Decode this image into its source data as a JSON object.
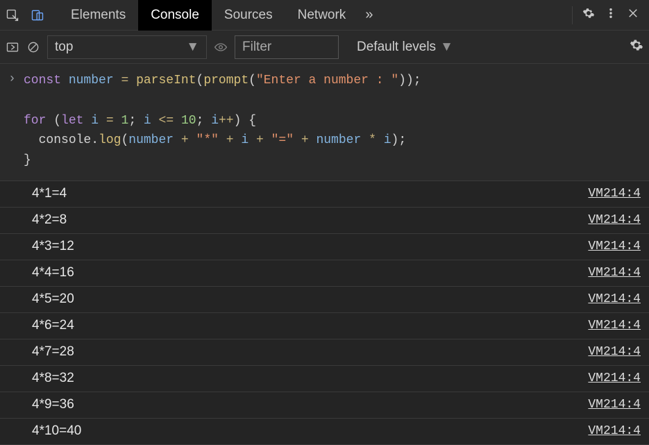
{
  "tabs": {
    "items": [
      "Elements",
      "Console",
      "Sources",
      "Network"
    ],
    "active": "Console",
    "overflow_glyph": "»"
  },
  "toolbar": {
    "context": "top",
    "filter_placeholder": "Filter",
    "levels_label": "Default levels"
  },
  "source_code": {
    "lines": [
      [
        {
          "t": "kw",
          "v": "const"
        },
        {
          "t": "sp",
          "v": " "
        },
        {
          "t": "var",
          "v": "number"
        },
        {
          "t": "sp",
          "v": " "
        },
        {
          "t": "op",
          "v": "="
        },
        {
          "t": "sp",
          "v": " "
        },
        {
          "t": "fn",
          "v": "parseInt"
        },
        {
          "t": "punc",
          "v": "("
        },
        {
          "t": "fn",
          "v": "prompt"
        },
        {
          "t": "punc",
          "v": "("
        },
        {
          "t": "str",
          "v": "\"Enter a number : \""
        },
        {
          "t": "punc",
          "v": "));"
        }
      ],
      [],
      [
        {
          "t": "kw",
          "v": "for"
        },
        {
          "t": "sp",
          "v": " "
        },
        {
          "t": "punc",
          "v": "("
        },
        {
          "t": "kw",
          "v": "let"
        },
        {
          "t": "sp",
          "v": " "
        },
        {
          "t": "var",
          "v": "i"
        },
        {
          "t": "sp",
          "v": " "
        },
        {
          "t": "op",
          "v": "="
        },
        {
          "t": "sp",
          "v": " "
        },
        {
          "t": "num",
          "v": "1"
        },
        {
          "t": "punc",
          "v": "; "
        },
        {
          "t": "var",
          "v": "i"
        },
        {
          "t": "sp",
          "v": " "
        },
        {
          "t": "op",
          "v": "<="
        },
        {
          "t": "sp",
          "v": " "
        },
        {
          "t": "num",
          "v": "10"
        },
        {
          "t": "punc",
          "v": "; "
        },
        {
          "t": "var",
          "v": "i"
        },
        {
          "t": "op",
          "v": "++"
        },
        {
          "t": "punc",
          "v": ") {"
        }
      ],
      [
        {
          "t": "sp",
          "v": "  "
        },
        {
          "t": "obj",
          "v": "console"
        },
        {
          "t": "punc",
          "v": "."
        },
        {
          "t": "fn",
          "v": "log"
        },
        {
          "t": "punc",
          "v": "("
        },
        {
          "t": "var",
          "v": "number"
        },
        {
          "t": "sp",
          "v": " "
        },
        {
          "t": "op",
          "v": "+"
        },
        {
          "t": "sp",
          "v": " "
        },
        {
          "t": "str",
          "v": "\"*\""
        },
        {
          "t": "sp",
          "v": " "
        },
        {
          "t": "op",
          "v": "+"
        },
        {
          "t": "sp",
          "v": " "
        },
        {
          "t": "var",
          "v": "i"
        },
        {
          "t": "sp",
          "v": " "
        },
        {
          "t": "op",
          "v": "+"
        },
        {
          "t": "sp",
          "v": " "
        },
        {
          "t": "str",
          "v": "\"=\""
        },
        {
          "t": "sp",
          "v": " "
        },
        {
          "t": "op",
          "v": "+"
        },
        {
          "t": "sp",
          "v": " "
        },
        {
          "t": "var",
          "v": "number"
        },
        {
          "t": "sp",
          "v": " "
        },
        {
          "t": "op",
          "v": "*"
        },
        {
          "t": "sp",
          "v": " "
        },
        {
          "t": "var",
          "v": "i"
        },
        {
          "t": "punc",
          "v": ");"
        }
      ],
      [
        {
          "t": "punc",
          "v": "}"
        }
      ]
    ]
  },
  "logs": [
    {
      "message": "4*1=4",
      "source": "VM214:4"
    },
    {
      "message": "4*2=8",
      "source": "VM214:4"
    },
    {
      "message": "4*3=12",
      "source": "VM214:4"
    },
    {
      "message": "4*4=16",
      "source": "VM214:4"
    },
    {
      "message": "4*5=20",
      "source": "VM214:4"
    },
    {
      "message": "4*6=24",
      "source": "VM214:4"
    },
    {
      "message": "4*7=28",
      "source": "VM214:4"
    },
    {
      "message": "4*8=32",
      "source": "VM214:4"
    },
    {
      "message": "4*9=36",
      "source": "VM214:4"
    },
    {
      "message": "4*10=40",
      "source": "VM214:4"
    }
  ]
}
